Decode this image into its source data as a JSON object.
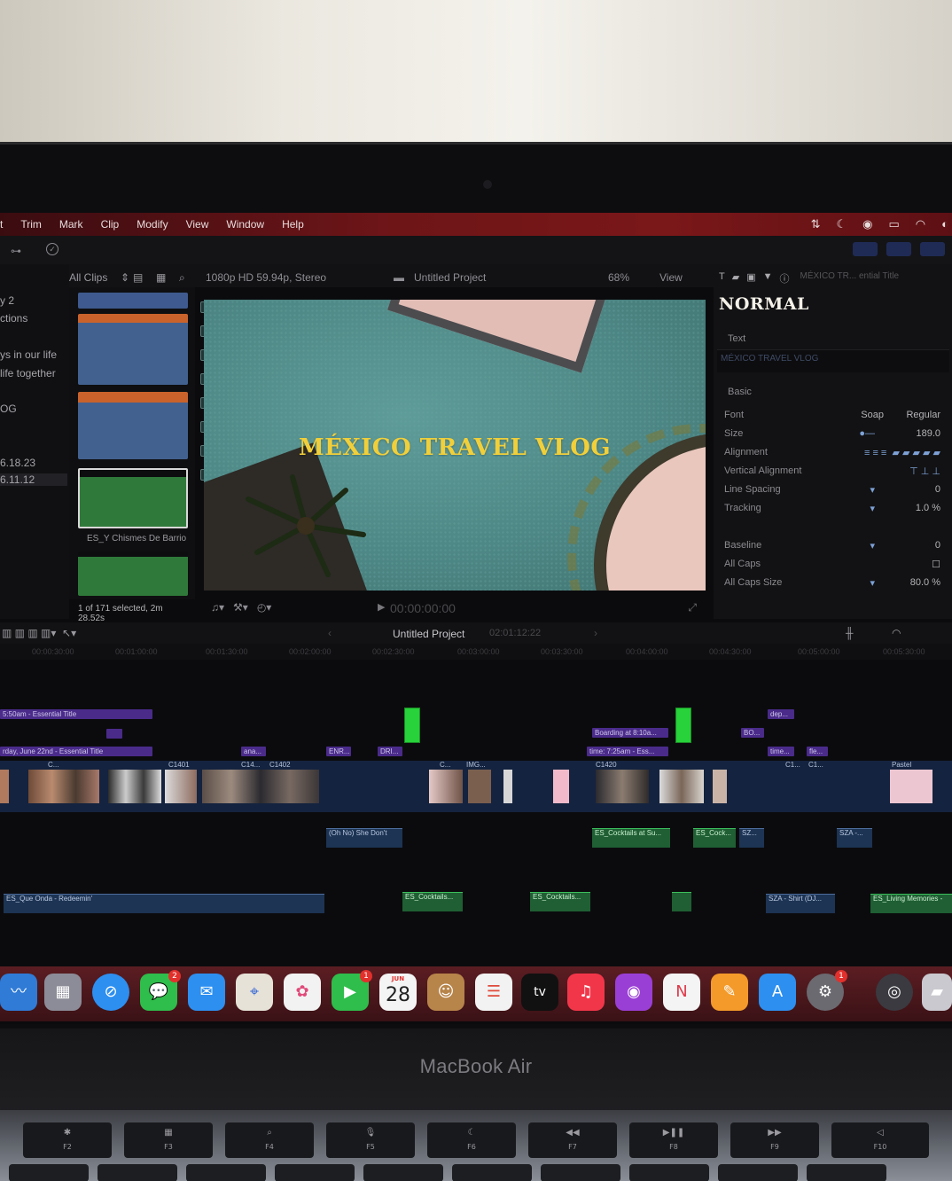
{
  "menubar": {
    "items": [
      "t",
      "Trim",
      "Mark",
      "Clip",
      "Modify",
      "View",
      "Window",
      "Help"
    ]
  },
  "libraries": {
    "rows": [
      "y 2",
      "ctions",
      "ys in our life",
      "life together",
      "OG",
      "6.18.23",
      "6.11.12"
    ]
  },
  "browser": {
    "filter": "All Clips",
    "clip_name": "ES_Y Chismes De Barrio",
    "selection_status": "1 of 171 selected, 2m 28.52s"
  },
  "viewer": {
    "format": "1080p HD 59.94p, Stereo",
    "project": "Untitled Project",
    "zoom": "68%",
    "view_menu": "View",
    "title_overlay": "MÉXICO TRAVEL VLOG",
    "timecode": "00:00:00:00"
  },
  "inspector": {
    "crumb": "MÉXICO TR... ential Title",
    "preset": "NORMAL",
    "text_label": "Text",
    "text_value": "MÉXICO TRAVEL VLOG",
    "basic_label": "Basic",
    "rows": [
      {
        "label": "Font",
        "value": "Regular",
        "extra": "Soap"
      },
      {
        "label": "Size",
        "value": "189.0"
      },
      {
        "label": "Alignment",
        "value": ""
      },
      {
        "label": "Vertical Alignment",
        "value": ""
      },
      {
        "label": "Line Spacing",
        "value": "0"
      },
      {
        "label": "Tracking",
        "value": "1.0 %"
      },
      {
        "label": "Baseline",
        "value": "0"
      },
      {
        "label": "All Caps",
        "value": ""
      },
      {
        "label": "All Caps Size",
        "value": "80.0 %"
      }
    ]
  },
  "timeline": {
    "project": "Untitled Project",
    "duration": "02:01:12:22",
    "ruler": [
      "00:00:30:00",
      "00:01:00:00",
      "00:01:30:00",
      "00:02:00:00",
      "00:02:30:00",
      "00:03:00:00",
      "00:03:30:00",
      "00:04:00:00",
      "00:04:30:00",
      "00:05:00:00",
      "00:05:30:00"
    ],
    "titles": [
      "5:50am - Essential Title",
      "rday, June 22nd - Essential Title",
      "ana...",
      "ENR...",
      "DRI...",
      "Boarding at 8:10a...",
      "time: 7:25am - Ess...",
      "dep...",
      "BO...",
      "time...",
      "fle..."
    ],
    "story_labels": [
      "C...",
      "C1401",
      "C14...",
      "C1402",
      "C...",
      "C1420",
      "C1...",
      "IMG...",
      "C1...",
      "Pastel"
    ],
    "audio": [
      "(Oh No) She Don't",
      "ES_Cocktails at Su...",
      "ES_Cock...",
      "SZ...",
      "SZA -...",
      "ES_Que Onda - Redeemin'",
      "ES_Cocktails...",
      "ES_Cocktails...",
      "SZA - Shirt (DJ...",
      "ES_Living Memories -"
    ]
  },
  "dock": {
    "calendar_month": "JUN",
    "calendar_day": "28",
    "badges": {
      "messages": "2",
      "facetime": "1",
      "settings": "1"
    },
    "tv_label": "tv"
  },
  "device": {
    "brand": "MacBook Air",
    "fkeys": [
      "F2",
      "F3",
      "F4",
      "F5",
      "F6",
      "F7",
      "F8",
      "F9",
      "F10"
    ]
  }
}
